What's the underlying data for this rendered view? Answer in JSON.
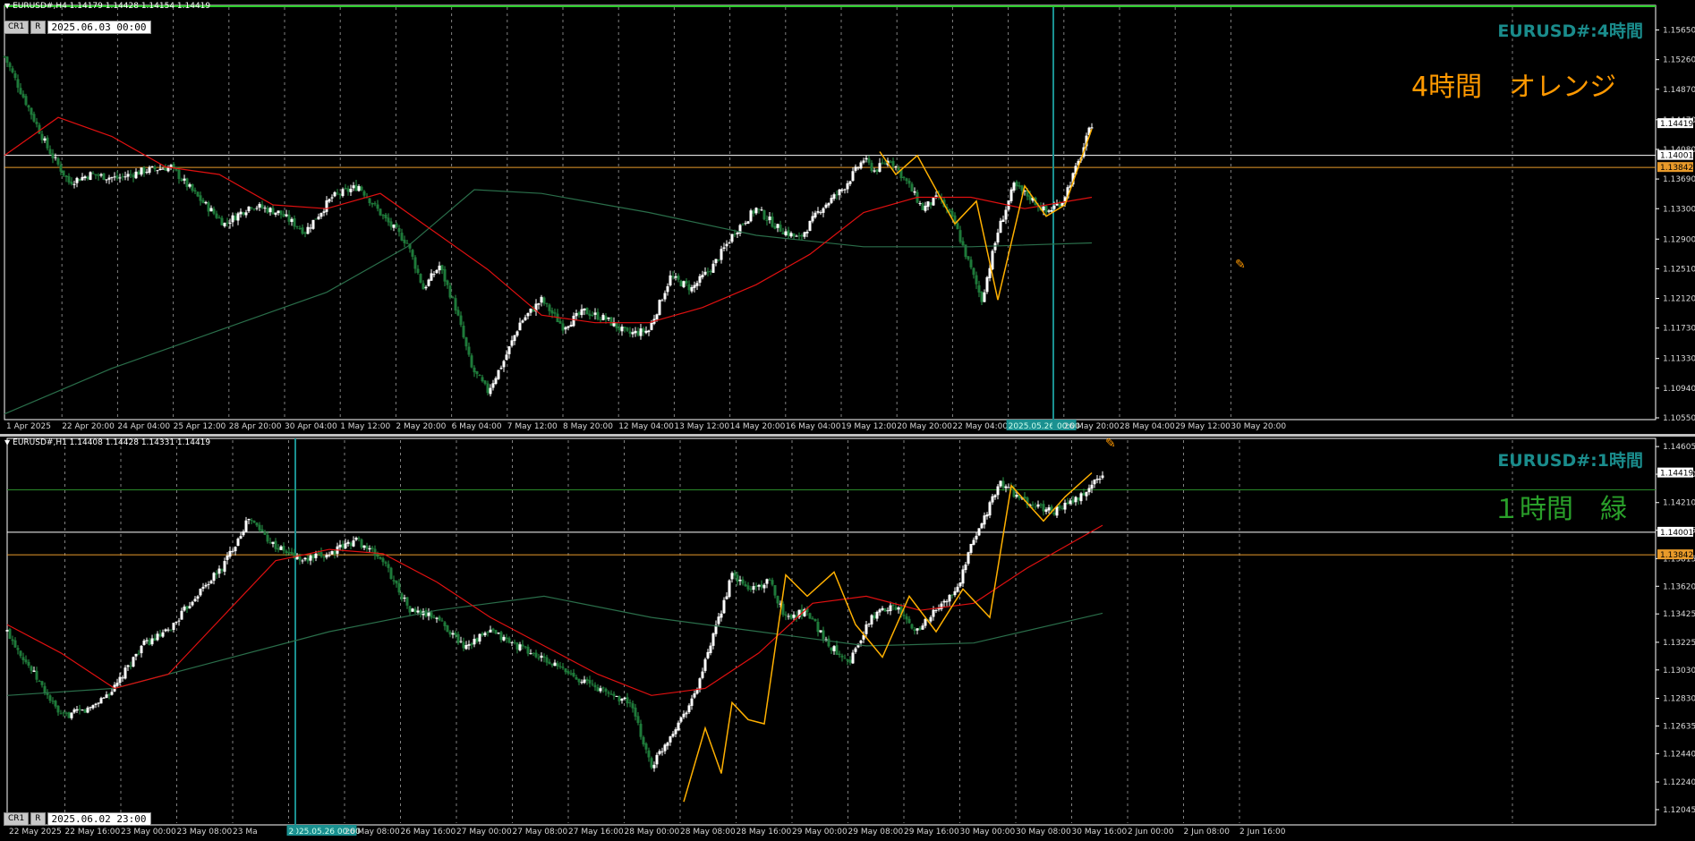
{
  "colors": {
    "bull": "#ffffff",
    "bear": "#1e7a3a",
    "ma_fast": "#e01010",
    "ma_slow": "#2a6e4a",
    "zigzag": "#ffb000",
    "cursor": "#1a9090",
    "level_white": "#ffffff",
    "level_orange": "#e89a2a",
    "level_green": "#2a8a2a",
    "accent_orange": "#ff9900"
  },
  "top": {
    "header": "EURUSD#,H4  1.14179 1.14428 1.14154 1.14419",
    "buttons": [
      "CR1",
      "R"
    ],
    "time_box": "2025.06.03 00:00",
    "symbol_label": "EURUSD#:4時間",
    "note": "4時間　オレンジ"
  },
  "bottom": {
    "header": "EURUSD#,H1  1.14408 1.14428 1.14331 1.14419",
    "buttons": [
      "CR1",
      "R"
    ],
    "time_box": "2025.06.02 23:00",
    "symbol_label": "EURUSD#:1時間",
    "note": "１時間　緑"
  },
  "chart_data": [
    {
      "type": "candlestick",
      "title": "EURUSD#,H4",
      "ylim": [
        1.1055,
        1.1595
      ],
      "y_ticks": [
        "1.15650",
        "1.15260",
        "1.14870",
        "1.14470",
        "1.14080",
        "1.13690",
        "1.13300",
        "1.12900",
        "1.12510",
        "1.12120",
        "1.11730",
        "1.11330",
        "1.10940",
        "1.10550"
      ],
      "x_ticks": [
        "1 Apr 2025",
        "22 Apr 20:00",
        "24 Apr 04:00",
        "25 Apr 12:00",
        "28 Apr 20:00",
        "30 Apr 04:00",
        "1 May 12:00",
        "2 May 20:00",
        "6 May 04:00",
        "7 May 12:00",
        "8 May 20:00",
        "12 May 04:00",
        "13 May 12:00",
        "14 May 20:00",
        "16 May 04:00",
        "19 May 12:00",
        "20 May 20:00",
        "22 May 04:00",
        "2025.05.26 00:00",
        "26 May 20:00",
        "28 May 04:00",
        "29 May 12:00",
        "30 May 20:00"
      ],
      "price_tags": [
        {
          "label": "1.14419",
          "value": 1.14419,
          "color": "#ffffff"
        },
        {
          "label": "1.14001",
          "value": 1.14001,
          "color": "#ffffff"
        },
        {
          "label": "1.13842",
          "value": 1.13842,
          "color": "#e89a2a"
        }
      ],
      "levels": [
        {
          "value": 1.14001,
          "color": "#ffffff"
        },
        {
          "value": 1.13842,
          "color": "#e89a2a"
        }
      ],
      "close_path": [
        [
          0,
          1.153
        ],
        [
          8,
          1.147
        ],
        [
          16,
          1.141
        ],
        [
          24,
          1.1365
        ],
        [
          32,
          1.1375
        ],
        [
          42,
          1.137
        ],
        [
          52,
          1.138
        ],
        [
          62,
          1.1385
        ],
        [
          72,
          1.1345
        ],
        [
          82,
          1.131
        ],
        [
          92,
          1.1335
        ],
        [
          102,
          1.1325
        ],
        [
          112,
          1.13
        ],
        [
          122,
          1.1345
        ],
        [
          132,
          1.136
        ],
        [
          142,
          1.1315
        ],
        [
          150,
          1.1285
        ],
        [
          156,
          1.1225
        ],
        [
          162,
          1.1255
        ],
        [
          168,
          1.12
        ],
        [
          174,
          1.112
        ],
        [
          180,
          1.109
        ],
        [
          186,
          1.113
        ],
        [
          192,
          1.118
        ],
        [
          200,
          1.121
        ],
        [
          208,
          1.1175
        ],
        [
          216,
          1.1195
        ],
        [
          224,
          1.1185
        ],
        [
          232,
          1.1165
        ],
        [
          240,
          1.117
        ],
        [
          248,
          1.124
        ],
        [
          256,
          1.1225
        ],
        [
          264,
          1.1255
        ],
        [
          272,
          1.13
        ],
        [
          280,
          1.133
        ],
        [
          288,
          1.1305
        ],
        [
          296,
          1.129
        ],
        [
          304,
          1.133
        ],
        [
          312,
          1.1355
        ],
        [
          320,
          1.1395
        ],
        [
          324,
          1.138
        ],
        [
          330,
          1.1395
        ],
        [
          336,
          1.1365
        ],
        [
          342,
          1.133
        ],
        [
          348,
          1.1345
        ],
        [
          354,
          1.131
        ],
        [
          360,
          1.125
        ],
        [
          364,
          1.121
        ],
        [
          370,
          1.13
        ],
        [
          376,
          1.136
        ],
        [
          382,
          1.1345
        ],
        [
          388,
          1.1325
        ],
        [
          394,
          1.134
        ],
        [
          400,
          1.139
        ],
        [
          405,
          1.1442
        ]
      ],
      "ma_fast": [
        [
          0,
          1.14
        ],
        [
          20,
          1.145
        ],
        [
          40,
          1.1425
        ],
        [
          60,
          1.1385
        ],
        [
          80,
          1.1375
        ],
        [
          100,
          1.1335
        ],
        [
          120,
          1.133
        ],
        [
          140,
          1.135
        ],
        [
          160,
          1.13
        ],
        [
          180,
          1.125
        ],
        [
          200,
          1.119
        ],
        [
          220,
          1.118
        ],
        [
          240,
          1.118
        ],
        [
          260,
          1.12
        ],
        [
          280,
          1.123
        ],
        [
          300,
          1.127
        ],
        [
          320,
          1.1325
        ],
        [
          340,
          1.1345
        ],
        [
          360,
          1.1345
        ],
        [
          380,
          1.133
        ],
        [
          405,
          1.1345
        ]
      ],
      "ma_slow": [
        [
          0,
          1.106
        ],
        [
          40,
          1.112
        ],
        [
          80,
          1.117
        ],
        [
          120,
          1.122
        ],
        [
          150,
          1.128
        ],
        [
          175,
          1.1355
        ],
        [
          200,
          1.135
        ],
        [
          240,
          1.1325
        ],
        [
          280,
          1.1295
        ],
        [
          320,
          1.128
        ],
        [
          360,
          1.128
        ],
        [
          405,
          1.1285
        ]
      ],
      "zigzag": [
        [
          326,
          1.1405
        ],
        [
          332,
          1.1375
        ],
        [
          340,
          1.14
        ],
        [
          354,
          1.131
        ],
        [
          362,
          1.134
        ],
        [
          370,
          1.121
        ],
        [
          380,
          1.136
        ],
        [
          388,
          1.132
        ],
        [
          395,
          1.1335
        ],
        [
          405,
          1.1435
        ]
      ]
    },
    {
      "type": "candlestick",
      "title": "EURUSD#,H1",
      "ylim": [
        1.1195,
        1.1465
      ],
      "y_ticks": [
        "1.14605",
        "1.14410",
        "1.14210",
        "1.14015",
        "1.13815",
        "1.13620",
        "1.13425",
        "1.13225",
        "1.13030",
        "1.12830",
        "1.12635",
        "1.12440",
        "1.12240",
        "1.12045"
      ],
      "x_ticks": [
        "22 May 2025",
        "22 May 16:00",
        "23 May 00:00",
        "23 May 08:00",
        "23 Ma",
        "2025.05.26 00:00",
        "26 May 08:00",
        "26 May 16:00",
        "27 May 00:00",
        "27 May 08:00",
        "27 May 16:00",
        "28 May 00:00",
        "28 May 08:00",
        "28 May 16:00",
        "29 May 00:00",
        "29 May 08:00",
        "29 May 16:00",
        "30 May 00:00",
        "30 May 08:00",
        "30 May 16:00",
        "2 Jun 00:00",
        "2 Jun 08:00",
        "2 Jun 16:00"
      ],
      "price_tags": [
        {
          "label": "1.14419",
          "value": 1.14419,
          "color": "#ffffff"
        },
        {
          "label": "1.14001",
          "value": 1.14001,
          "color": "#ffffff"
        },
        {
          "label": "1.13842",
          "value": 1.13842,
          "color": "#e89a2a"
        }
      ],
      "levels": [
        {
          "value": 1.143,
          "color": "#2a8a2a"
        },
        {
          "value": 1.14001,
          "color": "#ffffff"
        },
        {
          "value": 1.13842,
          "color": "#e89a2a"
        }
      ],
      "close_path": [
        [
          0,
          1.133
        ],
        [
          10,
          1.13
        ],
        [
          20,
          1.127
        ],
        [
          30,
          1.1275
        ],
        [
          40,
          1.129
        ],
        [
          50,
          1.132
        ],
        [
          60,
          1.133
        ],
        [
          70,
          1.1355
        ],
        [
          80,
          1.1375
        ],
        [
          90,
          1.141
        ],
        [
          100,
          1.139
        ],
        [
          110,
          1.138
        ],
        [
          120,
          1.1385
        ],
        [
          130,
          1.1395
        ],
        [
          140,
          1.138
        ],
        [
          150,
          1.1345
        ],
        [
          160,
          1.134
        ],
        [
          170,
          1.132
        ],
        [
          180,
          1.133
        ],
        [
          190,
          1.132
        ],
        [
          200,
          1.131
        ],
        [
          210,
          1.13
        ],
        [
          220,
          1.129
        ],
        [
          232,
          1.128
        ],
        [
          240,
          1.1235
        ],
        [
          248,
          1.126
        ],
        [
          256,
          1.1285
        ],
        [
          262,
          1.132
        ],
        [
          270,
          1.137
        ],
        [
          276,
          1.136
        ],
        [
          284,
          1.1365
        ],
        [
          290,
          1.134
        ],
        [
          298,
          1.1345
        ],
        [
          306,
          1.132
        ],
        [
          314,
          1.131
        ],
        [
          322,
          1.134
        ],
        [
          330,
          1.135
        ],
        [
          338,
          1.133
        ],
        [
          346,
          1.1345
        ],
        [
          354,
          1.136
        ],
        [
          360,
          1.1395
        ],
        [
          370,
          1.1435
        ],
        [
          380,
          1.142
        ],
        [
          390,
          1.1415
        ],
        [
          400,
          1.1425
        ],
        [
          408,
          1.1442
        ]
      ],
      "ma_fast": [
        [
          0,
          1.1335
        ],
        [
          20,
          1.1315
        ],
        [
          40,
          1.129
        ],
        [
          60,
          1.13
        ],
        [
          80,
          1.134
        ],
        [
          100,
          1.138
        ],
        [
          120,
          1.1388
        ],
        [
          140,
          1.1385
        ],
        [
          160,
          1.1365
        ],
        [
          180,
          1.134
        ],
        [
          200,
          1.132
        ],
        [
          220,
          1.13
        ],
        [
          240,
          1.1285
        ],
        [
          260,
          1.129
        ],
        [
          280,
          1.1315
        ],
        [
          300,
          1.135
        ],
        [
          320,
          1.1355
        ],
        [
          340,
          1.1345
        ],
        [
          360,
          1.135
        ],
        [
          380,
          1.1375
        ],
        [
          408,
          1.1405
        ]
      ],
      "ma_slow": [
        [
          0,
          1.1285
        ],
        [
          40,
          1.129
        ],
        [
          80,
          1.131
        ],
        [
          120,
          1.133
        ],
        [
          160,
          1.1345
        ],
        [
          200,
          1.1355
        ],
        [
          240,
          1.134
        ],
        [
          280,
          1.133
        ],
        [
          320,
          1.132
        ],
        [
          360,
          1.1322
        ],
        [
          408,
          1.1343
        ]
      ],
      "zigzag": [
        [
          252,
          1.121
        ],
        [
          260,
          1.1262
        ],
        [
          266,
          1.123
        ],
        [
          270,
          1.128
        ],
        [
          276,
          1.1268
        ],
        [
          282,
          1.1265
        ],
        [
          290,
          1.137
        ],
        [
          298,
          1.1355
        ],
        [
          308,
          1.1372
        ],
        [
          316,
          1.1335
        ],
        [
          326,
          1.1312
        ],
        [
          336,
          1.1355
        ],
        [
          346,
          1.133
        ],
        [
          356,
          1.136
        ],
        [
          366,
          1.134
        ],
        [
          374,
          1.1433
        ],
        [
          386,
          1.1408
        ],
        [
          394,
          1.1425
        ],
        [
          404,
          1.1442
        ]
      ]
    }
  ]
}
